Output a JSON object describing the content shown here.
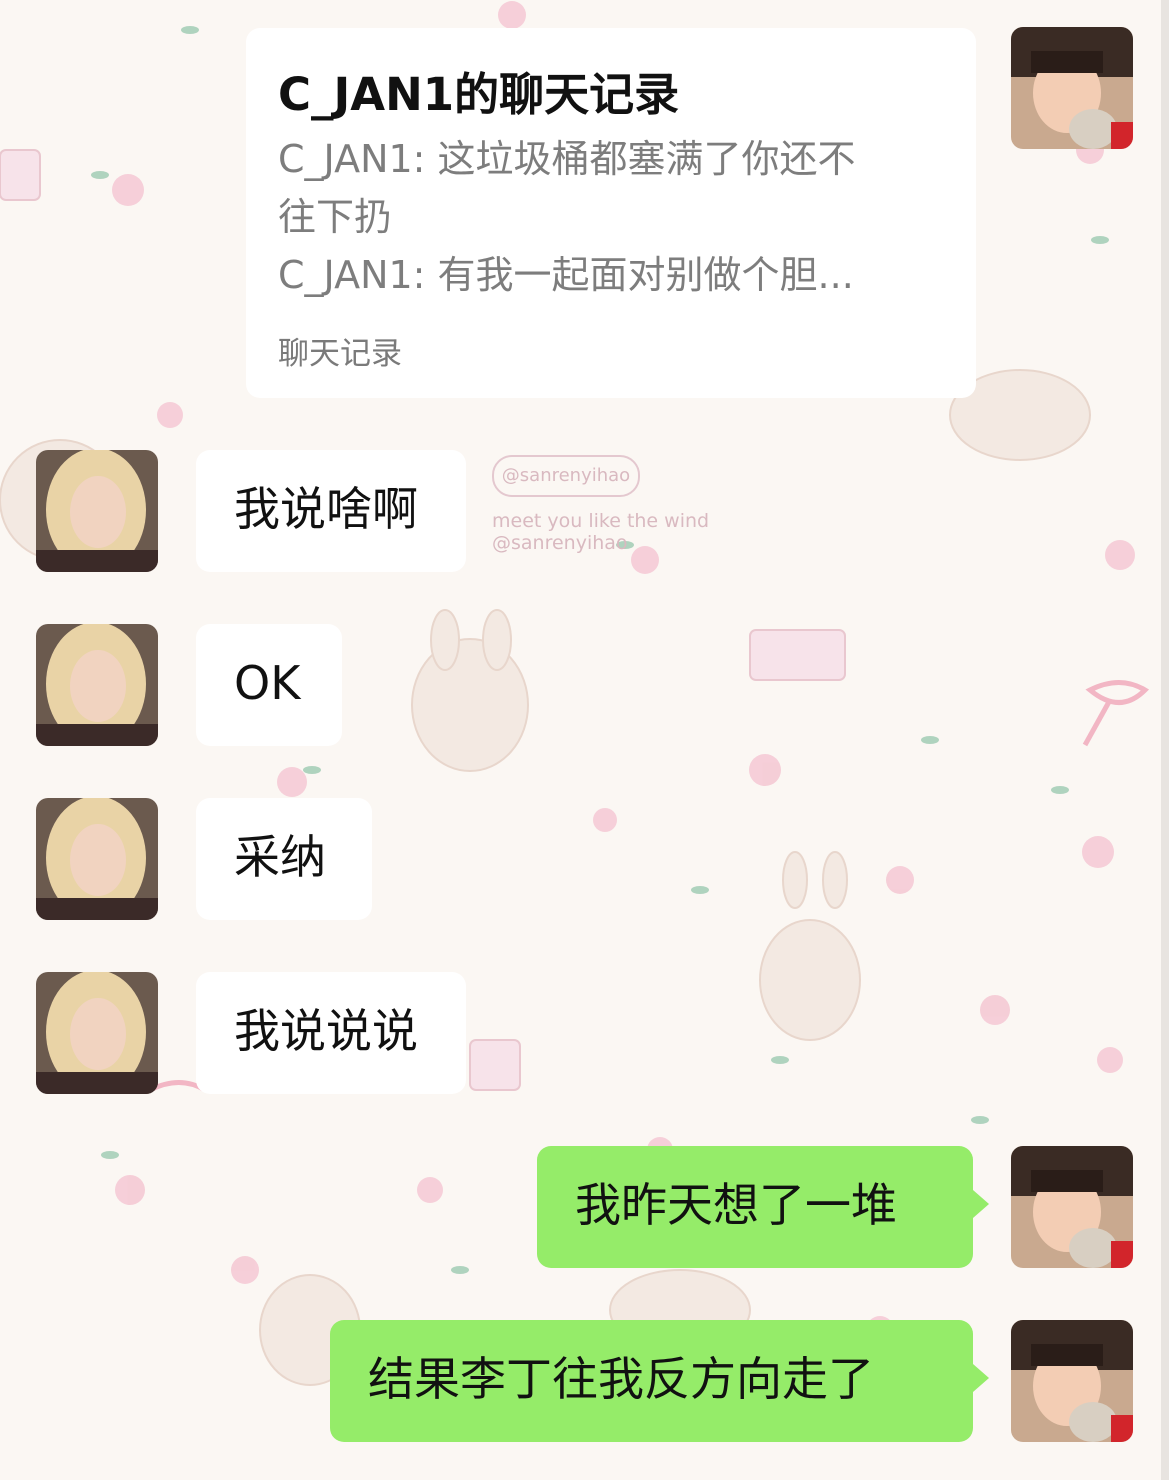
{
  "chat_record": {
    "title": "C_JAN1的聊天记录",
    "line1": "C_JAN1: 这垃圾桶都塞满了你还不",
    "line2": "往下扔",
    "line3": "C_JAN1: 有我一起面对别做个胆...",
    "footer": "聊天记录"
  },
  "watermark": {
    "badge": "@sanrenyihao",
    "line1": "meet you like the wind",
    "line2": "@sanrenyihao"
  },
  "messages": [
    {
      "side": "left",
      "text": "我说啥啊"
    },
    {
      "side": "left",
      "text": "OK"
    },
    {
      "side": "left",
      "text": "采纳"
    },
    {
      "side": "left",
      "text": "我说说说"
    },
    {
      "side": "right",
      "text": "我昨天想了一堆"
    },
    {
      "side": "right",
      "text": "结果李丁往我反方向走了"
    }
  ],
  "colors": {
    "self_bubble": "#95ec69",
    "other_bubble": "#ffffff",
    "background": "#fbf7f3"
  }
}
